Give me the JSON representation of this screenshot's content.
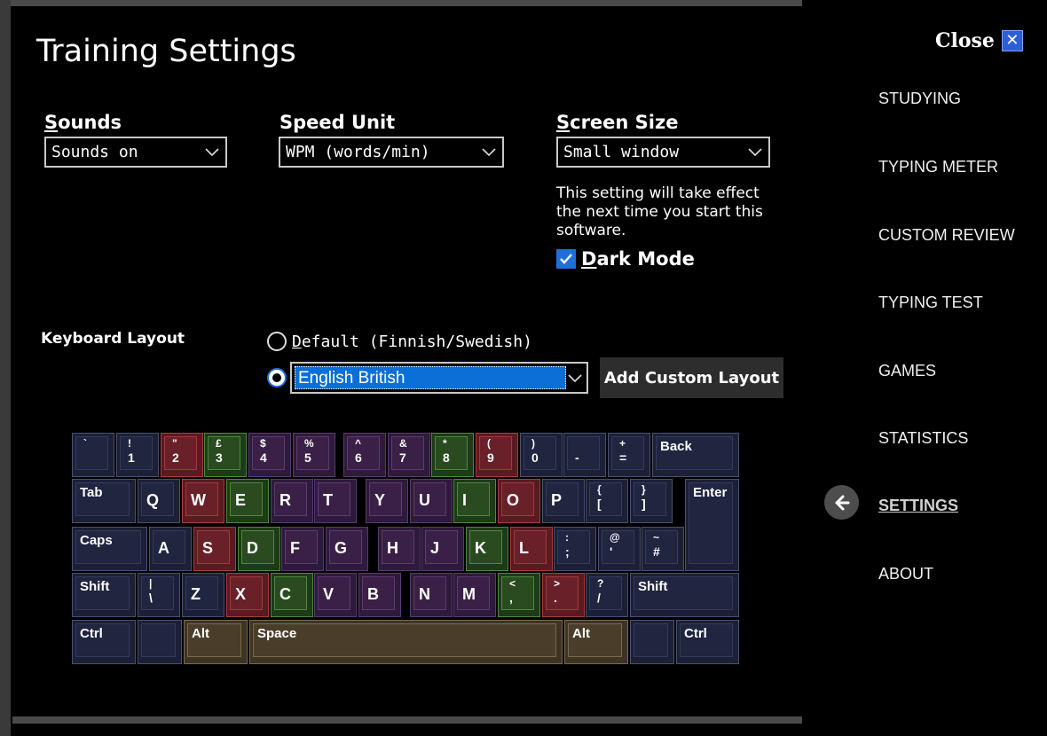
{
  "title": "Training Settings",
  "close": {
    "label": "Close",
    "icon": "close-icon"
  },
  "nav": [
    {
      "label": "STUDYING",
      "active": false
    },
    {
      "label": "TYPING METER",
      "active": false
    },
    {
      "label": "CUSTOM REVIEW",
      "active": false
    },
    {
      "label": "TYPING TEST",
      "active": false
    },
    {
      "label": "GAMES",
      "active": false
    },
    {
      "label": "STATISTICS",
      "active": false
    },
    {
      "label": "SETTINGS",
      "active": true
    },
    {
      "label": "ABOUT",
      "active": false
    }
  ],
  "sounds": {
    "label_first": "S",
    "label_rest": "ounds",
    "value": "Sounds on"
  },
  "speed_unit": {
    "label": "Speed Unit",
    "value": "WPM (words/min)"
  },
  "screen_size": {
    "label_first": "S",
    "label_rest": "creen Size",
    "value": "Small window",
    "note": "This setting will take effect the next time you start this software."
  },
  "dark_mode": {
    "label_first": "D",
    "label_rest": "ark Mode",
    "checked": true
  },
  "keyboard_layout": {
    "label": "Keyboard Layout",
    "option_default_first": "D",
    "option_default_rest": "efault (Finnish/Swedish)",
    "selected_layout": "English British",
    "add_button": "Add Custom Layout"
  },
  "keys": {
    "row1": [
      {
        "top": "`",
        "bot": "",
        "color": "blue"
      },
      {
        "top": "!",
        "bot": "1",
        "color": "blue"
      },
      {
        "top": "\"",
        "bot": "2",
        "color": "red"
      },
      {
        "top": "£",
        "bot": "3",
        "color": "green"
      },
      {
        "top": "$",
        "bot": "4",
        "color": "purple"
      },
      {
        "top": "%",
        "bot": "5",
        "color": "purple"
      },
      {
        "top": "^",
        "bot": "6",
        "color": "purple"
      },
      {
        "top": "&",
        "bot": "7",
        "color": "purple"
      },
      {
        "top": "*",
        "bot": "8",
        "color": "green"
      },
      {
        "top": "(",
        "bot": "9",
        "color": "red"
      },
      {
        "top": ")",
        "bot": "0",
        "color": "blue"
      },
      {
        "top": "",
        "bot": "-",
        "color": "blue"
      },
      {
        "top": "+",
        "bot": "=",
        "color": "blue"
      },
      {
        "top": "Back",
        "bot": "",
        "color": "blue"
      }
    ],
    "row2": [
      {
        "label": "Tab",
        "color": "blue"
      },
      {
        "label": "Q",
        "color": "blue"
      },
      {
        "label": "W",
        "color": "red"
      },
      {
        "label": "E",
        "color": "green"
      },
      {
        "label": "R",
        "color": "purple"
      },
      {
        "label": "T",
        "color": "purple"
      },
      {
        "label": "Y",
        "color": "purple"
      },
      {
        "label": "U",
        "color": "purple"
      },
      {
        "label": "I",
        "color": "green"
      },
      {
        "label": "O",
        "color": "red"
      },
      {
        "label": "P",
        "color": "blue"
      },
      {
        "top": "{",
        "bot": "[",
        "color": "blue"
      },
      {
        "top": "}",
        "bot": "]",
        "color": "blue"
      },
      {
        "label": "Enter",
        "color": "blue"
      }
    ],
    "row3": [
      {
        "label": "Caps",
        "color": "blue"
      },
      {
        "label": "A",
        "color": "blue"
      },
      {
        "label": "S",
        "color": "red"
      },
      {
        "label": "D",
        "color": "green"
      },
      {
        "label": "F",
        "color": "purple"
      },
      {
        "label": "G",
        "color": "purple"
      },
      {
        "label": "H",
        "color": "purple"
      },
      {
        "label": "J",
        "color": "purple"
      },
      {
        "label": "K",
        "color": "green"
      },
      {
        "label": "L",
        "color": "red"
      },
      {
        "top": ":",
        "bot": ";",
        "color": "blue"
      },
      {
        "top": "@",
        "bot": "'",
        "color": "blue"
      },
      {
        "top": "~",
        "bot": "#",
        "color": "blue"
      }
    ],
    "row4": [
      {
        "label": "Shift",
        "color": "blue"
      },
      {
        "top": "|",
        "bot": "\\",
        "color": "blue"
      },
      {
        "label": "Z",
        "color": "blue"
      },
      {
        "label": "X",
        "color": "red"
      },
      {
        "label": "C",
        "color": "green"
      },
      {
        "label": "V",
        "color": "purple"
      },
      {
        "label": "B",
        "color": "purple"
      },
      {
        "label": "N",
        "color": "purple"
      },
      {
        "label": "M",
        "color": "purple"
      },
      {
        "top": "<",
        "bot": ",",
        "color": "green"
      },
      {
        "top": ">",
        "bot": ".",
        "color": "red"
      },
      {
        "top": "?",
        "bot": "/",
        "color": "blue"
      },
      {
        "label": "Shift",
        "color": "blue"
      }
    ],
    "row5": [
      {
        "label": "Ctrl",
        "color": "blue"
      },
      {
        "label": "",
        "color": "blue"
      },
      {
        "label": "Alt",
        "color": "tan"
      },
      {
        "label": "Space",
        "color": "tan"
      },
      {
        "label": "Alt",
        "color": "tan"
      },
      {
        "label": "",
        "color": "blue"
      },
      {
        "label": "Ctrl",
        "color": "blue"
      }
    ]
  }
}
